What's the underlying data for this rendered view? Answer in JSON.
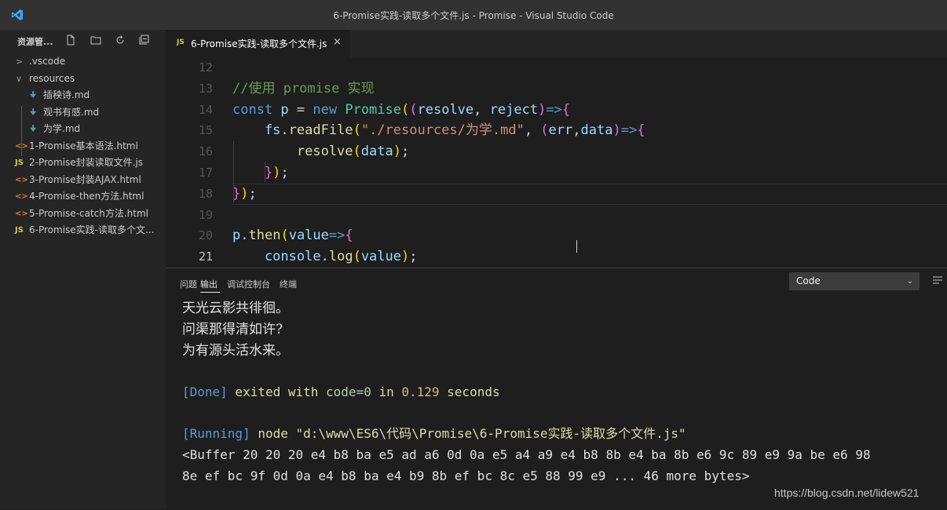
{
  "window": {
    "title": "6-Promise实践-读取多个文件.js - Promise - Visual Studio Code"
  },
  "explorer": {
    "title": "资源管...",
    "header_icons": [
      "new-file-icon",
      "new-folder-icon",
      "refresh-icon",
      "collapse-all-icon"
    ],
    "items": [
      {
        "chevron": ">",
        "label": ".vscode",
        "type": "folder",
        "depth": 0
      },
      {
        "chevron": "∨",
        "label": "resources",
        "type": "folder",
        "depth": 0
      },
      {
        "badge": "🠋",
        "label": "插秧诗.md",
        "type": "md",
        "depth": 1
      },
      {
        "badge": "🠋",
        "label": "观书有感.md",
        "type": "md",
        "depth": 1
      },
      {
        "badge": "🠋",
        "label": "为学.md",
        "type": "md",
        "depth": 1
      },
      {
        "badge": "<>",
        "label": "1-Promise基本语法.html",
        "type": "html",
        "depth": 0
      },
      {
        "badge": "JS",
        "label": "2-Promise封装读取文件.js",
        "type": "js",
        "depth": 0
      },
      {
        "badge": "<>",
        "label": "3-Promise封装AJAX.html",
        "type": "html",
        "depth": 0
      },
      {
        "badge": "<>",
        "label": "4-Promise-then方法.html",
        "type": "html",
        "depth": 0
      },
      {
        "badge": "<>",
        "label": "5-Promise-catch方法.html",
        "type": "html",
        "depth": 0
      },
      {
        "badge": "JS",
        "label": "6-Promise实践-读取多个文...",
        "type": "js",
        "depth": 0
      }
    ]
  },
  "editor": {
    "tab": {
      "badge": "JS",
      "label": "6-Promise实践-读取多个文件.js",
      "close": "×"
    },
    "lines": [
      {
        "n": "12",
        "tokens": []
      },
      {
        "n": "13",
        "tokens": [
          {
            "t": "//使用 promise 实现",
            "c": "t-cm"
          }
        ]
      },
      {
        "n": "14",
        "tokens": [
          {
            "t": "const ",
            "c": "t-kw"
          },
          {
            "t": "p",
            "c": "t-var"
          },
          {
            "t": " = ",
            "c": "t-wht"
          },
          {
            "t": "new ",
            "c": "t-kw"
          },
          {
            "t": "Promise",
            "c": "t-cls"
          },
          {
            "t": "(",
            "c": "t-par"
          },
          {
            "t": "(",
            "c": "t-par2"
          },
          {
            "t": "resolve",
            "c": "t-var"
          },
          {
            "t": ", ",
            "c": "t-wht"
          },
          {
            "t": "reject",
            "c": "t-var"
          },
          {
            "t": ")",
            "c": "t-par2"
          },
          {
            "t": "=>",
            "c": "t-kw"
          },
          {
            "t": "{",
            "c": "t-par2"
          }
        ]
      },
      {
        "n": "15",
        "tokens": [
          {
            "t": "    fs",
            "c": "t-var"
          },
          {
            "t": ".",
            "c": "t-wht"
          },
          {
            "t": "readFile",
            "c": "t-fn"
          },
          {
            "t": "(",
            "c": "t-par"
          },
          {
            "t": "\"./resources/为学.md\"",
            "c": "t-str"
          },
          {
            "t": ", ",
            "c": "t-wht"
          },
          {
            "t": "(",
            "c": "t-par2"
          },
          {
            "t": "err",
            "c": "t-var"
          },
          {
            "t": ",",
            "c": "t-wht"
          },
          {
            "t": "data",
            "c": "t-var"
          },
          {
            "t": ")",
            "c": "t-par2"
          },
          {
            "t": "=>",
            "c": "t-kw"
          },
          {
            "t": "{",
            "c": "t-par2"
          }
        ]
      },
      {
        "n": "16",
        "tokens": [
          {
            "t": "        resolve",
            "c": "t-fn"
          },
          {
            "t": "(",
            "c": "t-par"
          },
          {
            "t": "data",
            "c": "t-var"
          },
          {
            "t": ")",
            "c": "t-par"
          },
          {
            "t": ";",
            "c": "t-wht"
          }
        ]
      },
      {
        "n": "17",
        "tokens": [
          {
            "t": "    }",
            "c": "t-par2"
          },
          {
            "t": ")",
            "c": "t-par"
          },
          {
            "t": ";",
            "c": "t-wht"
          }
        ]
      },
      {
        "n": "18",
        "tokens": [
          {
            "t": "}",
            "c": "t-par2"
          },
          {
            "t": ")",
            "c": "t-par"
          },
          {
            "t": ";",
            "c": "t-wht"
          }
        ]
      },
      {
        "n": "19",
        "tokens": []
      },
      {
        "n": "20",
        "tokens": [
          {
            "t": "p",
            "c": "t-var"
          },
          {
            "t": ".",
            "c": "t-wht"
          },
          {
            "t": "then",
            "c": "t-fn"
          },
          {
            "t": "(",
            "c": "t-par"
          },
          {
            "t": "value",
            "c": "t-var"
          },
          {
            "t": "=>",
            "c": "t-kw"
          },
          {
            "t": "{",
            "c": "t-par2"
          }
        ]
      },
      {
        "n": "21",
        "tokens": [
          {
            "t": "    console",
            "c": "t-var"
          },
          {
            "t": ".",
            "c": "t-wht"
          },
          {
            "t": "log",
            "c": "t-fn"
          },
          {
            "t": "(",
            "c": "t-par"
          },
          {
            "t": "value",
            "c": "t-var"
          },
          {
            "t": ")",
            "c": "t-par"
          },
          {
            "t": ";",
            "c": "t-wht"
          }
        ]
      }
    ]
  },
  "panel": {
    "tabs": [
      "问题",
      "输出",
      "调试控制台",
      "终端"
    ],
    "active_tab": "输出",
    "channel": "Code",
    "output": [
      {
        "cn": true,
        "parts": [
          {
            "t": "天光云影共徘徊。",
            "c": "o-wht"
          }
        ]
      },
      {
        "cn": true,
        "parts": [
          {
            "t": "问渠那得清如许?",
            "c": "o-wht"
          }
        ]
      },
      {
        "cn": true,
        "parts": [
          {
            "t": "为有源头活水来。",
            "c": "o-wht"
          }
        ]
      },
      {
        "cn": false,
        "parts": []
      },
      {
        "cn": false,
        "parts": [
          {
            "t": "[Done]",
            "c": "o-blue"
          },
          {
            "t": " exited with ",
            "c": "o-yel"
          },
          {
            "t": "code=0",
            "c": "o-olive"
          },
          {
            "t": " in ",
            "c": "o-yel"
          },
          {
            "t": "0.129",
            "c": "o-ora"
          },
          {
            "t": " seconds",
            "c": "o-yel"
          }
        ]
      },
      {
        "cn": false,
        "parts": []
      },
      {
        "cn": false,
        "parts": [
          {
            "t": "[Running]",
            "c": "o-blue"
          },
          {
            "t": " node \"d:\\www\\ES6\\代码\\Promise\\6-Promise实践-读取多个文件.js\"",
            "c": "o-yel"
          }
        ]
      },
      {
        "cn": false,
        "parts": [
          {
            "t": "<Buffer 20 20 20 e4 b8 ba e5 ad a6 0d 0a e5 a4 a9 e4 b8 8b e4 ba 8b e6 9c 89 e9 9a be e6 98",
            "c": "o-wht"
          }
        ]
      },
      {
        "cn": false,
        "parts": [
          {
            "t": "8e ef bc 9f 0d 0a e4 b8 ba e4 b9 8b ef bc 8c e5 88 99 e9 ... 46 more bytes>",
            "c": "o-wht"
          }
        ]
      }
    ]
  },
  "watermark": "https://blog.csdn.net/lidew521"
}
